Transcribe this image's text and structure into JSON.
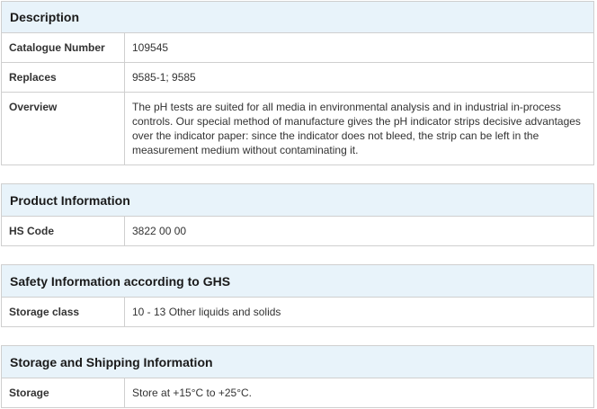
{
  "sections": [
    {
      "title": "Description",
      "rows": [
        {
          "label": "Catalogue Number",
          "value": "109545"
        },
        {
          "label": "Replaces",
          "value": "9585-1; 9585"
        },
        {
          "label": "Overview",
          "value": "The pH tests are suited for all media in environmental analysis and in industrial in-process controls. Our special method of manufacture gives the pH indicator strips decisive advantages over the indicator paper: since the indicator does not bleed, the strip can be left in the measurement medium without contaminating it."
        }
      ]
    },
    {
      "title": "Product Information",
      "rows": [
        {
          "label": "HS Code",
          "value": "3822 00 00"
        }
      ]
    },
    {
      "title": "Safety Information according to GHS",
      "rows": [
        {
          "label": "Storage class",
          "value": "10 - 13 Other liquids and solids"
        }
      ]
    },
    {
      "title": "Storage and Shipping Information",
      "rows": [
        {
          "label": "Storage",
          "value": "Store at +15°C to +25°C."
        }
      ]
    }
  ]
}
